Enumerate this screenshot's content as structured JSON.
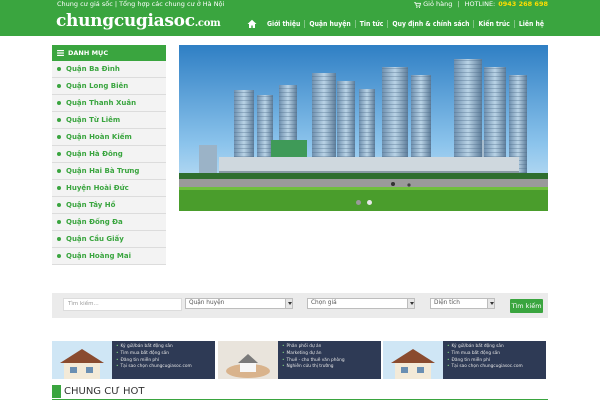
{
  "header": {
    "tagline": "Chung cư giá sốc | Tổng hợp các chung cư ở Hà Nội",
    "cart_label": "Giỏ hàng",
    "hotline_label": "HOTLINE:",
    "hotline_number": "0943 268 698",
    "logo_main": "chungcugiasoc",
    "logo_suffix": ".com"
  },
  "nav": {
    "home_icon": "home-icon",
    "items": [
      {
        "label": "Giới thiệu"
      },
      {
        "label": "Quận huyện"
      },
      {
        "label": "Tin tức"
      },
      {
        "label": "Quy định & chính sách"
      },
      {
        "label": "Kiến trúc"
      },
      {
        "label": "Liên hệ"
      }
    ]
  },
  "sidebar": {
    "heading": "DANH MỤC",
    "items": [
      {
        "label": "Quận Ba Đình"
      },
      {
        "label": "Quận Long Biên"
      },
      {
        "label": "Quận Thanh Xuân"
      },
      {
        "label": "Quận Từ Liêm"
      },
      {
        "label": "Quận Hoàn Kiếm"
      },
      {
        "label": "Quận Hà Đông"
      },
      {
        "label": "Quận Hai Bà Trưng"
      },
      {
        "label": "Huyện Hoài Đức"
      },
      {
        "label": "Quận Tây Hồ"
      },
      {
        "label": "Quận Đống Đa"
      },
      {
        "label": "Quận Cầu Giấy"
      },
      {
        "label": "Quận Hoàng Mai"
      }
    ]
  },
  "slider": {
    "slide_count": 2,
    "active_slide": 2
  },
  "search": {
    "keyword_placeholder": "Tìm kiếm...",
    "district_value": "Quận huyện",
    "price_value": "Chọn giá",
    "area_value": "Diện tích",
    "button_label": "Tìm kiếm"
  },
  "banners": [
    {
      "lines": [
        "Ký gửi/bán bất động sản",
        "Tìm mua bất động sản",
        "Đăng tin miễn phí",
        "Tại sao chọn chungcugiasoc.com"
      ]
    },
    {
      "lines": [
        "Phân phối dự án",
        "Marketing dự án",
        "Thuê - cho thuê văn phòng",
        "Nghiên cứu thị trường"
      ]
    },
    {
      "lines": [
        "Ký gửi/bán bất động sản",
        "Tìm mua bất động sản",
        "Đăng tin miễn phí",
        "Tại sao chọn chungcugiasoc.com"
      ]
    }
  ],
  "section": {
    "title": "CHUNG CƯ HOT"
  },
  "colors": {
    "brand_green": "#3aa53f",
    "hotline_yellow": "#ffde00"
  }
}
